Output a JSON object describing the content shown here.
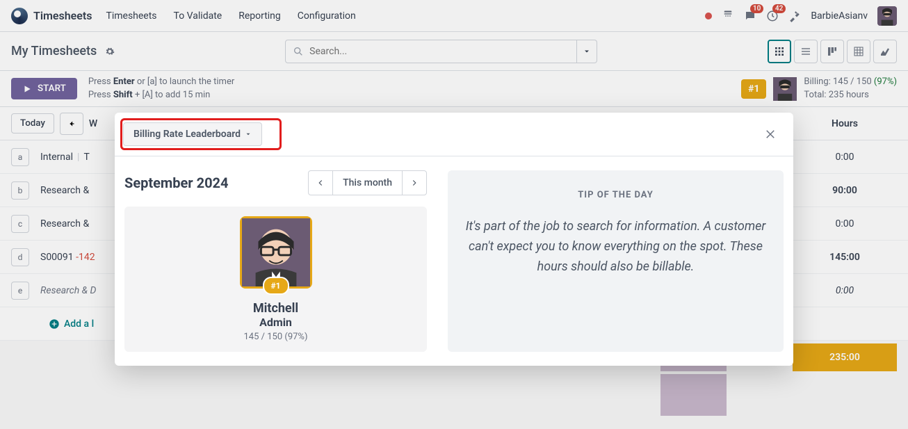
{
  "app": {
    "name": "Timesheets"
  },
  "nav": {
    "links": [
      "Timesheets",
      "To Validate",
      "Reporting",
      "Configuration"
    ]
  },
  "tray": {
    "messages_badge": "10",
    "activities_badge": "42",
    "username": "BarbieAsianv"
  },
  "page": {
    "title": "My Timesheets",
    "search_placeholder": "Search..."
  },
  "action": {
    "start_label": "START",
    "hint1_a": "Press ",
    "hint1_b": "Enter",
    "hint1_c": " or [a] to launch the timer",
    "hint2_a": "Press ",
    "hint2_b": "Shift",
    "hint2_c": " + [A] to add 15 min",
    "rank_badge": "#1",
    "billing_line": "Billing: 145 / 150 ",
    "billing_pct": "(97%)",
    "total_line": "Total: 235 hours"
  },
  "grid": {
    "today_label": "Today",
    "col_hours": "Hours",
    "rows": [
      {
        "key": "a",
        "label": "Internal",
        "sep": "|",
        "extra": "T",
        "hours": "0:00"
      },
      {
        "key": "b",
        "label": "Research & ",
        "hours": "90:00"
      },
      {
        "key": "c",
        "label": "Research & ",
        "hours": "0:00"
      },
      {
        "key": "d",
        "label": "S00091 ",
        "neg": "-142",
        "hours": "145:00"
      },
      {
        "key": "e",
        "label": "Research & D",
        "hours": "0:00",
        "italic": true
      }
    ],
    "add_line": "Add a l",
    "totals": {
      "col": "235:00",
      "grand": "235:00"
    }
  },
  "modal": {
    "toggle_label": "Billing Rate Leaderboard",
    "month": "September 2024",
    "period_label": "This month",
    "leader": {
      "rank": "#1",
      "name": "Mitchell",
      "role": "Admin",
      "stats": "145 / 150 (97%)"
    },
    "tip": {
      "title": "TIP OF THE DAY",
      "body": "It's part of the job to search for information. A customer can't expect you to know everything on the spot. These hours should also be billable."
    }
  }
}
